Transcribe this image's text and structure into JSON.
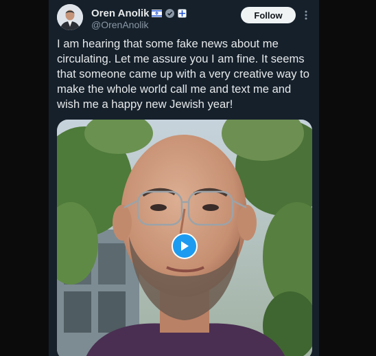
{
  "tweet": {
    "author_name": "Oren Anolik",
    "handle": "@OrenAnolik",
    "follow_label": "Follow",
    "text": "I am hearing that some fake news about me circulating. Let me assure you I am fine. It seems that someone came up with a very creative way to make the whole world call me and text me and wish me a happy new Jewish year!"
  },
  "icons": {
    "badges": [
      "israel-flag-icon",
      "verified-badge-icon",
      "affiliate-badge-icon"
    ],
    "more": "more-options-icon",
    "play": "play-icon"
  },
  "colors": {
    "background": "#15202b",
    "text": "#e7e9ea",
    "secondary_text": "#8b98a5",
    "accent": "#1d9bf0",
    "follow_bg": "#eff3f4"
  }
}
